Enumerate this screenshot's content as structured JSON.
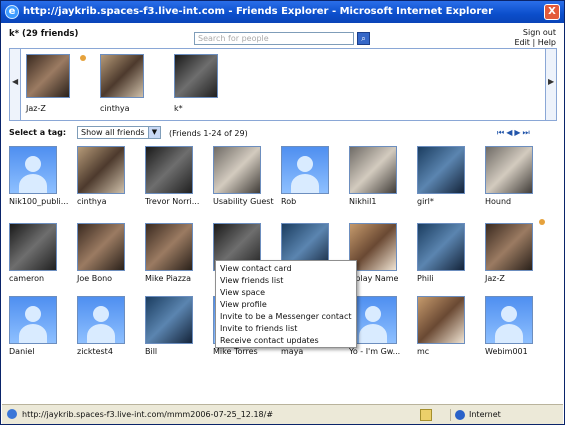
{
  "window": {
    "title": "http://jaykrib.spaces-f3.live-int.com - Friends Explorer - Microsoft Internet Explorer",
    "close_label": "X"
  },
  "header": {
    "title": "k* (29 friends)",
    "search_placeholder": "Search for people",
    "sign_out": "Sign out",
    "edit": "Edit",
    "help": "Help",
    "separator": "|"
  },
  "carousel": {
    "items": [
      {
        "name": "Jaz-Z",
        "photo": "photo1",
        "online": true
      },
      {
        "name": "cinthya",
        "photo": "photo2",
        "online": false
      },
      {
        "name": "k*",
        "photo": "photo3",
        "online": false
      }
    ]
  },
  "tags": {
    "label": "Select a tag:",
    "selected": "Show all friends",
    "count": "(Friends 1-24 of 29)",
    "pager": "⏮◀▶⏭"
  },
  "friends": [
    {
      "name": "Nik100_publi...",
      "photo": "gen"
    },
    {
      "name": "cinthya",
      "photo": "photo2"
    },
    {
      "name": "Trevor Norri...",
      "photo": "photo3"
    },
    {
      "name": "Usability Guest",
      "photo": "photo4"
    },
    {
      "name": "Rob",
      "photo": "gen"
    },
    {
      "name": "Nikhil1",
      "photo": "photo4"
    },
    {
      "name": "girl*",
      "photo": "photo5"
    },
    {
      "name": "Hound",
      "photo": "photo4"
    },
    {
      "name": "cameron",
      "photo": "photo3"
    },
    {
      "name": "Joe Bono",
      "photo": "photo1"
    },
    {
      "name": "Mike Piazza",
      "photo": "photo1"
    },
    {
      "name": "",
      "photo": "photo3"
    },
    {
      "name": "",
      "photo": "photo5"
    },
    {
      "name": "isplay Name",
      "photo": "photo6"
    },
    {
      "name": "Phili",
      "photo": "photo5"
    },
    {
      "name": "Jaz-Z",
      "photo": "photo1"
    },
    {
      "name": "Daniel",
      "photo": "gen"
    },
    {
      "name": "zicktest4",
      "photo": "gen"
    },
    {
      "name": "Bill",
      "photo": "photo5"
    },
    {
      "name": "Mike Torres",
      "photo": "gen"
    },
    {
      "name": "maya",
      "photo": "gen"
    },
    {
      "name": "Yo - I'm Gw...",
      "photo": "gen"
    },
    {
      "name": "mc",
      "photo": "photo6"
    },
    {
      "name": "Webim001",
      "photo": "gen"
    }
  ],
  "context_menu": {
    "items": [
      "View contact card",
      "View friends list",
      "View space",
      "View profile",
      "Invite to be a Messenger contact",
      "Invite to friends list",
      "Receive contact updates"
    ]
  },
  "status": {
    "url": "http://jaykrib.spaces-f3.live-int.com/mmm2006-07-25_12.18/#",
    "zone": "Internet"
  }
}
